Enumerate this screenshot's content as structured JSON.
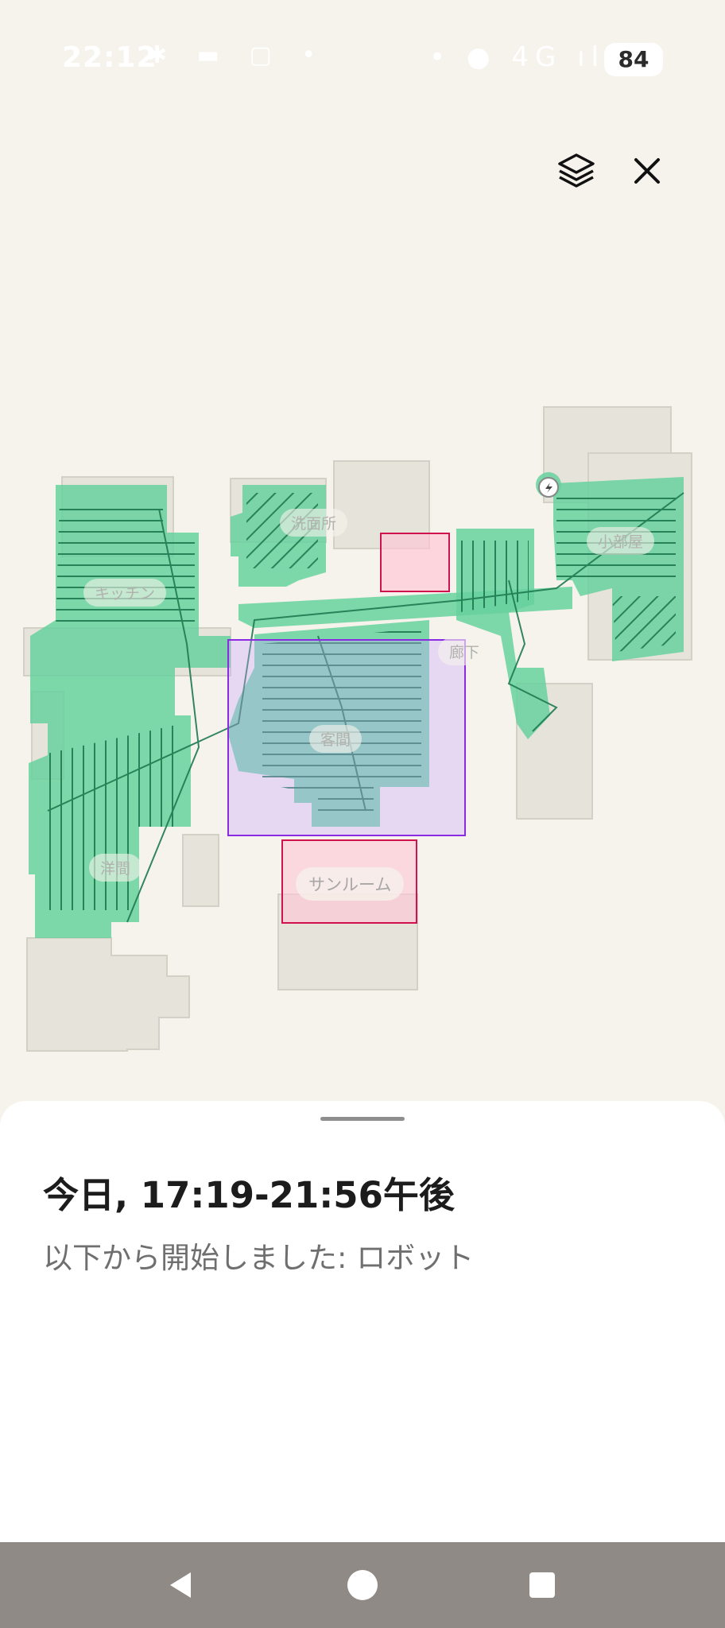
{
  "status_bar": {
    "time": "22:12",
    "left_icons": "✱ ▬ ▢ •",
    "right_icons": "• ● 4G ıll",
    "battery": "84"
  },
  "toolbar": {
    "layers_icon": "layers-icon",
    "close_icon": "close-icon"
  },
  "map": {
    "rooms": {
      "kitchen": "キッチン",
      "washroom": "洗面所",
      "small_room": "小部屋",
      "hallway": "廊下",
      "living": "客間",
      "western_room": "洋間"
    },
    "zone_label": "サンルーム",
    "colors": {
      "floor": "#e7e5dc",
      "cleaned": "#5fcf9b",
      "path": "#1e7a50",
      "no_go_zone": "#d0124e",
      "selected_zone": "#8a2be2"
    }
  },
  "sheet": {
    "title": "今日, 17:19-21:56午後",
    "subtitle": "以下から開始しました: ロボット"
  },
  "nav": {
    "back_icon": "back-icon",
    "home_icon": "home-icon",
    "recents_icon": "recents-icon"
  }
}
